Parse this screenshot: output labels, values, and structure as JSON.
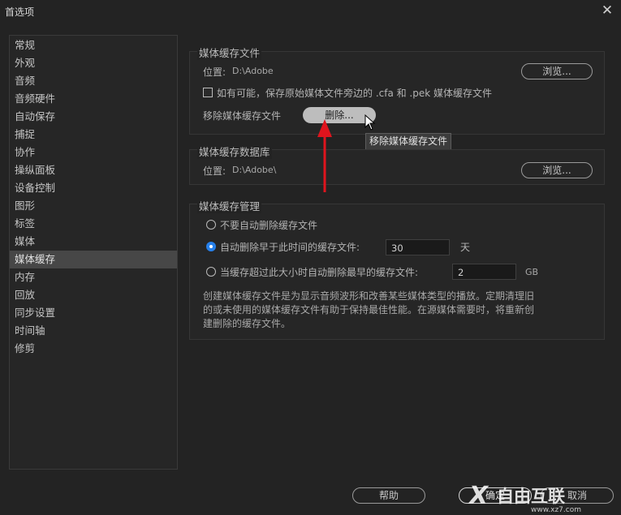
{
  "window": {
    "title": "首选项"
  },
  "sidebar": {
    "items": [
      "常规",
      "外观",
      "音频",
      "音频硬件",
      "自动保存",
      "捕捉",
      "协作",
      "操纵面板",
      "设备控制",
      "图形",
      "标签",
      "媒体",
      "媒体缓存",
      "内存",
      "回放",
      "同步设置",
      "时间轴",
      "修剪"
    ],
    "selected": "媒体缓存"
  },
  "cache_files": {
    "title": "媒体缓存文件",
    "location_label": "位置:",
    "location_value": "D:\\Adobe",
    "browse_label": "浏览...",
    "checkbox_label": "如有可能，保存原始媒体文件旁边的 .cfa 和 .pek 媒体缓存文件",
    "checkbox_checked": false,
    "remove_label": "移除媒体缓存文件",
    "delete_label": "删除...",
    "tooltip": "移除媒体缓存文件"
  },
  "cache_db": {
    "title": "媒体缓存数据库",
    "location_label": "位置:",
    "location_value": "D:\\Adobe\\",
    "browse_label": "浏览..."
  },
  "cache_mgmt": {
    "title": "媒体缓存管理",
    "options": [
      {
        "label": "不要自动删除缓存文件",
        "selected": false
      },
      {
        "label": "自动删除早于此时间的缓存文件:",
        "selected": true,
        "value": "30",
        "unit": "天"
      },
      {
        "label": "当缓存超过此大小时自动删除最早的缓存文件:",
        "selected": false,
        "value": "2",
        "unit": "GB"
      }
    ],
    "description": "创建媒体缓存文件是为显示音频波形和改善某些媒体类型的播放。定期清理旧的或未使用的媒体缓存文件有助于保持最佳性能。在源媒体需要时，将重新创建删除的缓存文件。"
  },
  "footer": {
    "help": "帮助",
    "ok": "确定",
    "cancel": "取消"
  },
  "watermark": {
    "brand": "自由互联",
    "url": "www.xz7.com"
  },
  "colors": {
    "accent": "#2680eb",
    "annotation": "#e0141d",
    "background": "#232323"
  }
}
